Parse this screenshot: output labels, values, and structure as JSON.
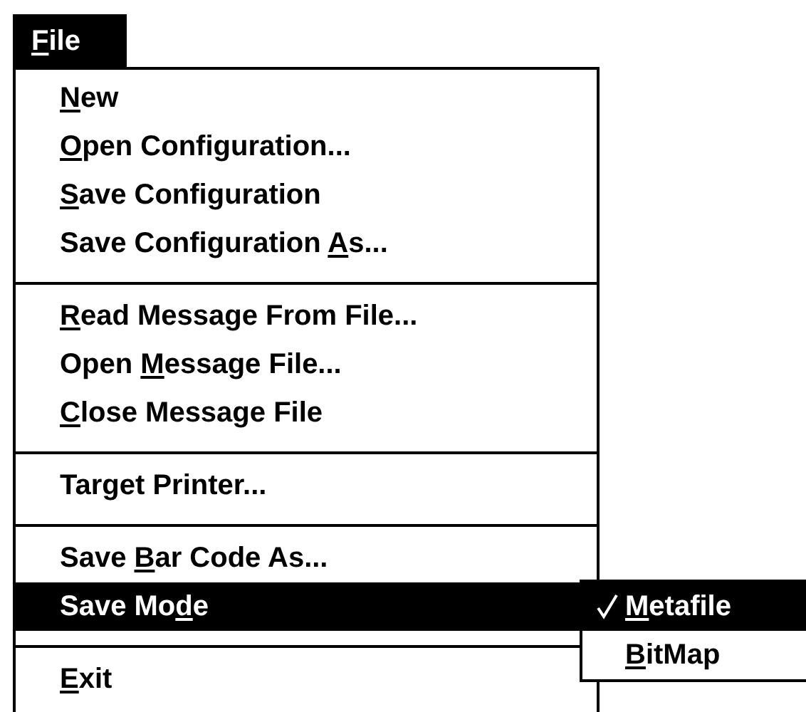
{
  "menu_bar": [
    {
      "key": "F",
      "post": "ile",
      "selected": true
    }
  ],
  "menu": {
    "groups": [
      [
        {
          "key": "N",
          "post": "ew",
          "selected": false
        },
        {
          "key": "O",
          "post": "pen Configuration...",
          "selected": false
        },
        {
          "key": "S",
          "post": "ave Configuration",
          "selected": false
        },
        {
          "pre": "Save Configuration ",
          "key": "A",
          "post": "s...",
          "selected": false
        }
      ],
      [
        {
          "key": "R",
          "post": "ead Message From File...",
          "selected": false
        },
        {
          "pre": "Open ",
          "key": "M",
          "post": "essage File...",
          "selected": false
        },
        {
          "key": "C",
          "post": "lose Message File",
          "selected": false
        }
      ],
      [
        {
          "pre": "Target Printer...",
          "selected": false
        }
      ],
      [
        {
          "pre": "Save ",
          "key": "B",
          "post": "ar Code As...",
          "selected": false
        },
        {
          "pre": "Save Mo",
          "key": "d",
          "post": "e",
          "selected": true,
          "submenu": [
            {
              "key": "M",
              "post": "etafile",
              "selected": true,
              "checked": true
            },
            {
              "key": "B",
              "post": "itMap",
              "selected": false,
              "checked": false
            }
          ]
        }
      ],
      [
        {
          "key": "E",
          "post": "xit",
          "selected": false
        }
      ]
    ]
  }
}
